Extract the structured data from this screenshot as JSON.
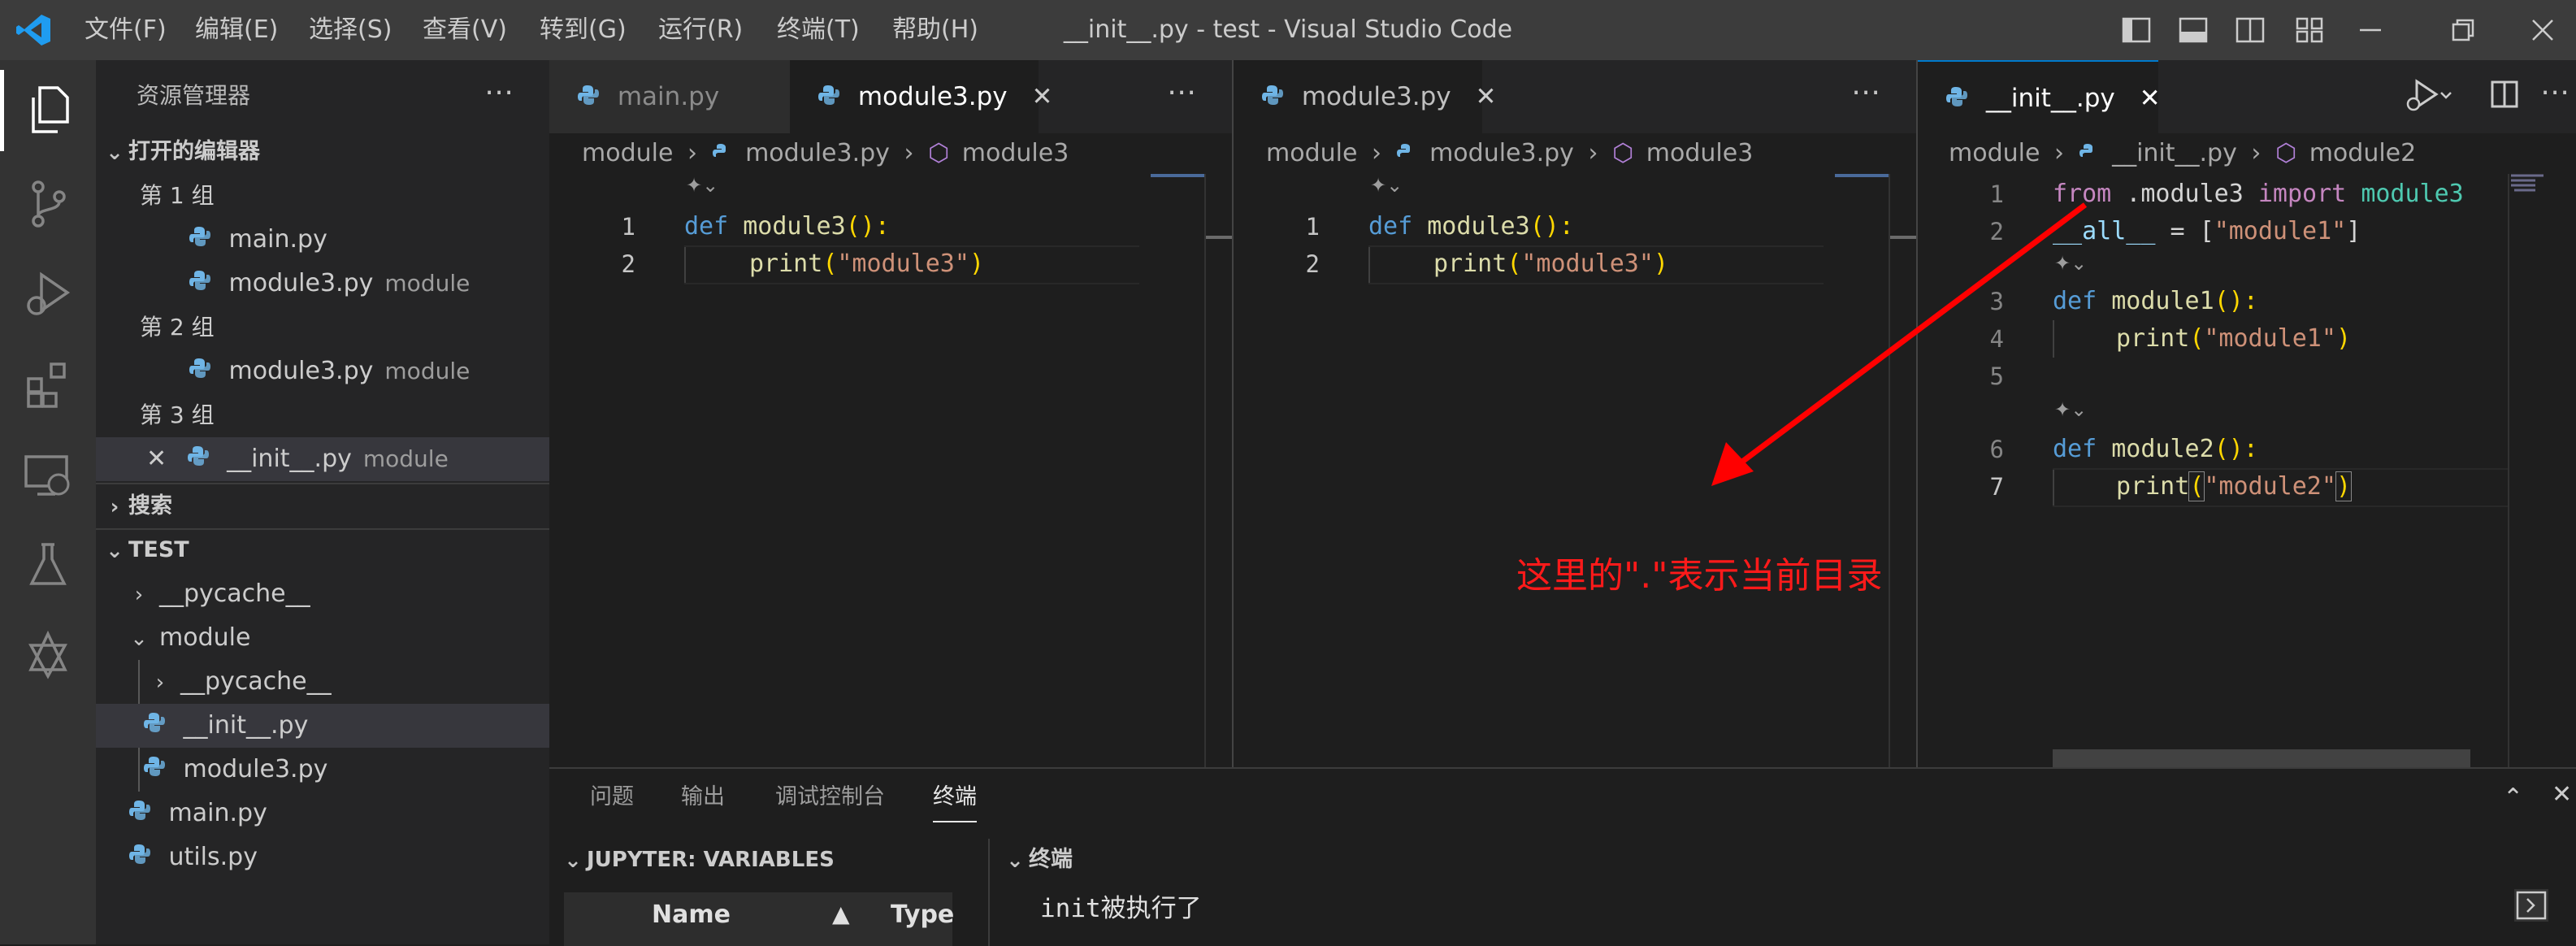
{
  "titlebar": {
    "menu": [
      "文件(F)",
      "编辑(E)",
      "选择(S)",
      "查看(V)",
      "转到(G)",
      "运行(R)",
      "终端(T)",
      "帮助(H)"
    ],
    "title": "__init__.py - test - Visual Studio Code"
  },
  "sidebar": {
    "header": "资源管理器",
    "open_editors_label": "打开的编辑器",
    "group1": "第 1 组",
    "group2": "第 2 组",
    "group3": "第 3 组",
    "g1_file1": "main.py",
    "g1_file2": "module3.py",
    "g1_file2_desc": "module",
    "g2_file1": "module3.py",
    "g2_file1_desc": "module",
    "g3_file1": "__init__.py",
    "g3_file1_desc": "module",
    "search_label": "搜索",
    "project_label": "TEST",
    "tree": {
      "pycache": "__pycache__",
      "module": "module",
      "module_pycache": "__pycache__",
      "module_init": "__init__.py",
      "module_module3": "module3.py",
      "main": "main.py",
      "utils": "utils.py"
    }
  },
  "editor1": {
    "tab1": "main.py",
    "tab2": "module3.py",
    "bc_folder": "module",
    "bc_file": "module3.py",
    "bc_symbol": "module3",
    "lines": [
      {
        "n": "1",
        "kw": "def",
        "fn": "module3",
        "rest": "():"
      },
      {
        "n": "2",
        "fn": "print",
        "str": "\"module3\""
      }
    ]
  },
  "editor2": {
    "tab1": "module3.py",
    "bc_folder": "module",
    "bc_file": "module3.py",
    "bc_symbol": "module3",
    "lines": [
      {
        "n": "1",
        "kw": "def",
        "fn": "module3",
        "rest": "():"
      },
      {
        "n": "2",
        "fn": "print",
        "str": "\"module3\""
      }
    ]
  },
  "editor3": {
    "tab1": "__init__.py",
    "bc_folder": "module",
    "bc_file": "__init__.py",
    "bc_symbol": "module2",
    "lines": [
      {
        "n": "1",
        "from": "from",
        "dotmod": ".module3",
        "import": "import",
        "mod": "module3"
      },
      {
        "n": "2",
        "var": "__all__",
        "eq": " = [",
        "str": "\"module1\"",
        "end": "]"
      },
      {
        "n": "3",
        "kw": "def",
        "fn": "module1",
        "rest": "():"
      },
      {
        "n": "4",
        "fn": "print",
        "str": "\"module1\""
      },
      {
        "n": "5"
      },
      {
        "n": "6",
        "kw": "def",
        "fn": "module2",
        "rest": "():"
      },
      {
        "n": "7",
        "fn": "print",
        "str": "\"module2\""
      }
    ]
  },
  "annotation": {
    "text": "这里的\".\"表示当前目录",
    "color": "#ff0000"
  },
  "panel": {
    "tabs": [
      "问题",
      "输出",
      "调试控制台",
      "终端"
    ],
    "active_tab": "终端",
    "variables_header": "JUPYTER: VARIABLES",
    "col_name": "Name",
    "col_type": "Type",
    "terminal_header": "终端",
    "terminal_output": "init被执行了"
  },
  "colors": {
    "accent": "#007acc",
    "titlebar": "#3c3c3c",
    "activitybar": "#333333",
    "sidebar": "#252526",
    "editor": "#1e1e1e"
  }
}
